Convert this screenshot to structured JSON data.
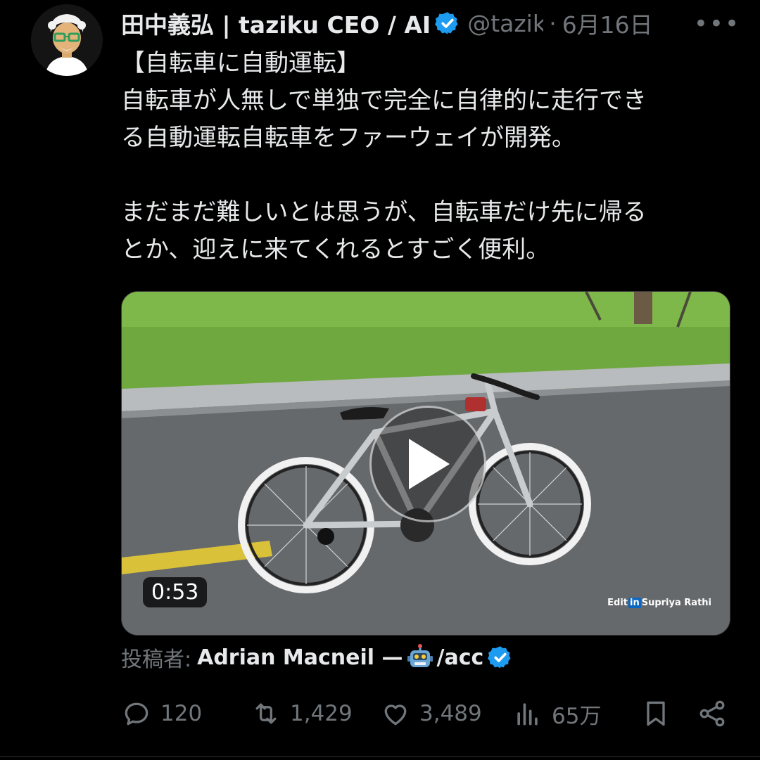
{
  "author": {
    "name": "田中義弘 | taziku CEO / AI",
    "handle": "@tazik",
    "separator": "·",
    "date": "6月16日"
  },
  "tweet": {
    "text": "【自転車に自動運転】\n自転車が人無しで単独で完全に自律的に走行でき\nる自動運転自転車をファーウェイが開発。\n\nまだまだ難しいとは思うが、自転車だけ先に帰る\nとか、迎えに来てくれるとすごく便利。"
  },
  "media": {
    "duration": "0:53",
    "watermark_prefix": "Edit",
    "watermark_in": "in",
    "watermark_name": "Supriya Rathi"
  },
  "attribution": {
    "label": "投稿者:",
    "name": "Adrian Macneil —",
    "handle": "/acc"
  },
  "actions": {
    "replies": "120",
    "reposts": "1,429",
    "likes": "3,489",
    "views": "65万"
  },
  "colors": {
    "background": "#000000",
    "text": "#e7e9ea",
    "muted": "#71767b",
    "verified": "#1d9bf0"
  },
  "icons": [
    "more-icon",
    "verified-badge-icon",
    "play-icon",
    "robot-emoji-icon",
    "reply-icon",
    "repost-icon",
    "like-icon",
    "views-icon",
    "bookmark-icon",
    "share-icon"
  ]
}
